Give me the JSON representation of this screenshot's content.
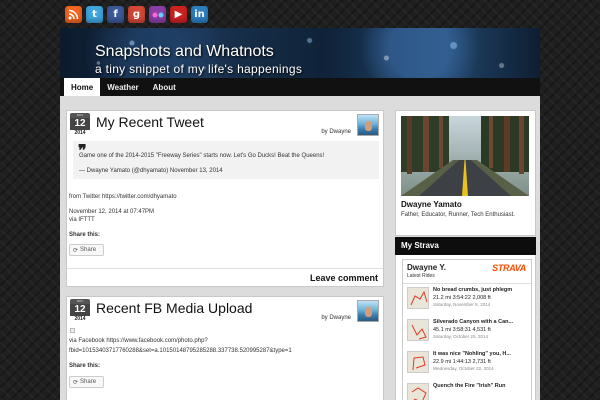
{
  "social": {
    "icons": [
      {
        "name": "rss-icon",
        "glyph": "◉",
        "color": "#f26522"
      },
      {
        "name": "twitter-icon",
        "glyph": "t",
        "color": "#3ea6dd"
      },
      {
        "name": "facebook-icon",
        "glyph": "f",
        "color": "#3b5998"
      },
      {
        "name": "google-plus-icon",
        "glyph": "g",
        "color": "#d34836"
      },
      {
        "name": "flickr-icon",
        "glyph": "●●",
        "color": "#8a3fa6"
      },
      {
        "name": "youtube-icon",
        "glyph": "▶",
        "color": "#cc2222"
      },
      {
        "name": "linkedin-icon",
        "glyph": "in",
        "color": "#2b7fc0"
      }
    ]
  },
  "header": {
    "title": "Snapshots and Whatnots",
    "tagline": "a tiny snippet of my life's happenings"
  },
  "nav": {
    "items": [
      "Home",
      "Weather",
      "About"
    ]
  },
  "posts": [
    {
      "date": {
        "month": "NOV",
        "day": "12",
        "year": "2014"
      },
      "title": "My Recent Tweet",
      "byline": "by Dwayne",
      "tweet_text": "Game one of the 2014-2015 \"Freeway Series\" starts now. Let's Go Ducks! Beat the Queens!",
      "tweet_author": "— Dwayne Yamato (@dhyamato) November 13, 2014",
      "body_line1": "from Twitter https://twitter.com/dhyamato",
      "body_line2": "November 12, 2014 at 07:47PM",
      "body_line3": "via IFTTT",
      "share_label": "Share this:",
      "share_button": "Share",
      "leave_comment": "Leave comment"
    },
    {
      "date": {
        "month": "NOV",
        "day": "12",
        "year": "2014"
      },
      "title": "Recent FB Media Upload",
      "byline": "by Dwayne",
      "body_line1": "via Facebook https://www.facebook.com/photo.php?",
      "body_line2": "fbid=10153403717760288&set=a.10150148795285288.337738.520995287&type=1",
      "share_label": "Share this:",
      "share_button": "Share"
    }
  ],
  "sidebar": {
    "profile": {
      "name": "Dwayne Yamato",
      "bio": "Father, Educator, Runner, Tech Enthusiast."
    },
    "strava": {
      "heading": "My Strava",
      "athlete": "Dwayne Y.",
      "latest": "Latest Rides",
      "logo": "STRAVA",
      "rides": [
        {
          "title": "No bread crumbs, just phlegm",
          "stats": "21.2 mi   3:54:22   2,008 ft",
          "date": "Saturday, November 8, 2014"
        },
        {
          "title": "Silverado Canyon with a Can...",
          "stats": "45.1 mi   3:58:31   4,531 ft",
          "date": "Saturday, October 25, 2014"
        },
        {
          "title": "It was nice \"Nohling\" you, H...",
          "stats": "22.9 mi   1:44:13   2,731 ft",
          "date": "Wednesday, October 22, 2014"
        },
        {
          "title": "Quench the Fire \"Irish\" Run",
          "stats": "",
          "date": ""
        }
      ]
    }
  }
}
